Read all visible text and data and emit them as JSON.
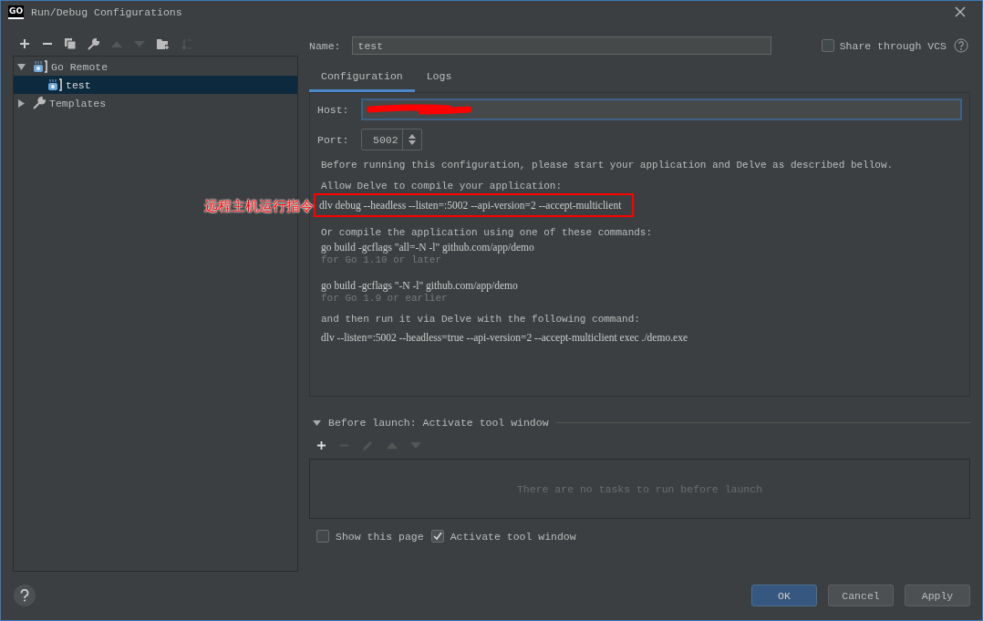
{
  "window": {
    "title": "Run/Debug Configurations",
    "app_icon": "GO"
  },
  "tree": [
    {
      "label": "Go Remote",
      "expanded": true,
      "selected": false,
      "kind": "remote",
      "children": [
        {
          "label": "test",
          "selected": true,
          "kind": "remote"
        }
      ]
    },
    {
      "label": "Templates",
      "expanded": false,
      "selected": false,
      "kind": "templates"
    }
  ],
  "name_field": {
    "label": "Name:",
    "value": "test"
  },
  "share": {
    "label": "Share through VCS",
    "checked": false
  },
  "tabs": [
    {
      "label": "Configuration",
      "selected": true
    },
    {
      "label": "Logs",
      "selected": false
    }
  ],
  "host": {
    "label": "Host:",
    "redacted": true
  },
  "port": {
    "label": "Port:",
    "value": "5002"
  },
  "lines": [
    {
      "kind": "text",
      "text": "Before running this configuration, please start your application and Delve as described bellow."
    },
    {
      "kind": "text",
      "text": "Allow Delve to compile your application:"
    },
    {
      "kind": "command",
      "highlighted": true,
      "text": "dlv debug --headless --listen=:5002 --api-version=2 --accept-multiclient"
    },
    {
      "kind": "text",
      "text": "Or compile the application using one of these commands:"
    },
    {
      "kind": "command",
      "highlighted": false,
      "text": "go build -gcflags \"all=-N -l\" github.com/app/demo"
    },
    {
      "kind": "note",
      "text": "for Go 1.10 or later"
    },
    {
      "kind": "command",
      "highlighted": false,
      "text": "go build -gcflags \"-N -l\" github.com/app/demo"
    },
    {
      "kind": "note",
      "text": "for Go 1.9 or earlier"
    },
    {
      "kind": "text",
      "text": "and then run it via Delve with the following command:"
    },
    {
      "kind": "command",
      "highlighted": false,
      "text": "dlv --listen=:5002 --headless=true --api-version=2 --accept-multiclient exec ./demo.exe"
    }
  ],
  "annotation": {
    "text": "远程主机运行指令"
  },
  "before_launch": {
    "title": "Before launch: Activate tool window",
    "expanded": true,
    "empty_text": "There are no tasks to run before launch"
  },
  "options": [
    {
      "label": "Show this page",
      "checked": false
    },
    {
      "label": "Activate tool window",
      "checked": true
    }
  ],
  "buttons": [
    {
      "label": "OK",
      "kind": "primary"
    },
    {
      "label": "Cancel",
      "kind": "normal"
    },
    {
      "label": "Apply",
      "kind": "normal"
    }
  ]
}
